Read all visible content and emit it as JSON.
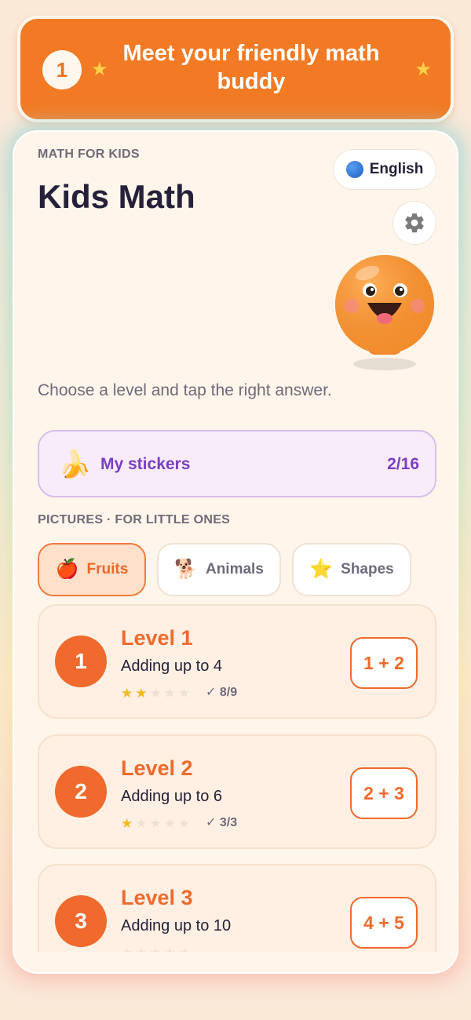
{
  "banner": {
    "step": "1",
    "title": "Meet your friendly math buddy"
  },
  "header": {
    "eyebrow": "MATH FOR KIDS",
    "title": "Kids Math",
    "language": "English",
    "subtitle": "Choose a level and tap the right answer."
  },
  "stickers": {
    "icon": "🍌",
    "label": "My stickers",
    "count": "2/16"
  },
  "section_label": "PICTURES · FOR LITTLE ONES",
  "tabs": [
    {
      "icon": "🍎",
      "label": "Fruits",
      "active": true
    },
    {
      "icon": "🐕",
      "label": "Animals",
      "active": false
    },
    {
      "icon": "⭐",
      "label": "Shapes",
      "active": false
    }
  ],
  "levels": [
    {
      "num": "1",
      "title": "Level 1",
      "sub": "Adding up to 4",
      "stars": 2,
      "progress": "✓ 8/9",
      "sum": "1 + 2"
    },
    {
      "num": "2",
      "title": "Level 2",
      "sub": "Adding up to 6",
      "stars": 1,
      "progress": "✓ 3/3",
      "sum": "2 + 3"
    },
    {
      "num": "3",
      "title": "Level 3",
      "sub": "Adding up to 10",
      "stars": 0,
      "progress": "",
      "sum": "4 + 5"
    }
  ],
  "colors": {
    "accent": "#ef6a2c",
    "banner": "#f27a24",
    "sticker_purple": "#7b3ec2",
    "star": "#f5b81e"
  }
}
